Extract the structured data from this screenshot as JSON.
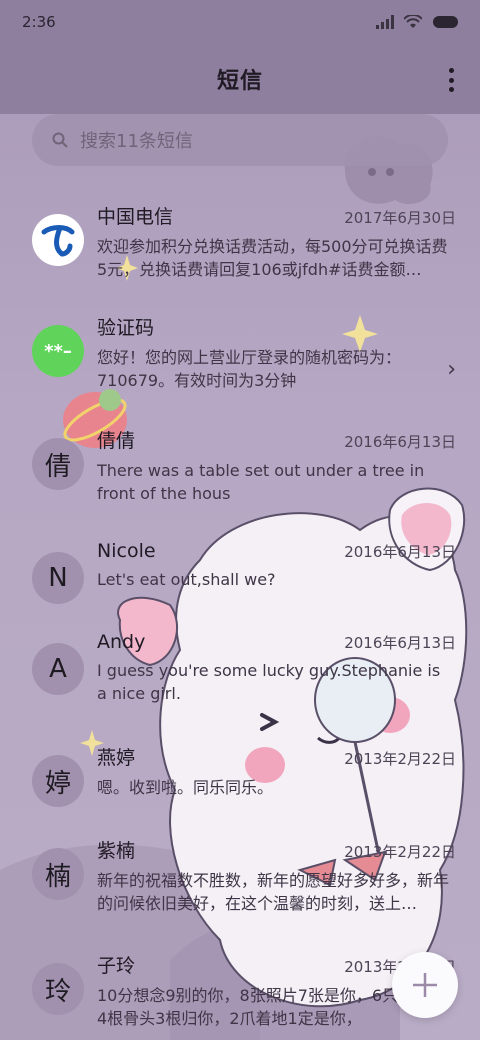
{
  "status": {
    "time": "2:36"
  },
  "header": {
    "title": "短信"
  },
  "search": {
    "placeholder": "搜索11条短信"
  },
  "conversations": [
    {
      "avatar_text": "",
      "avatar_icon": "china-telecom-logo-icon",
      "name": "中国电信",
      "date": "2017年6月30日",
      "snippet": "欢迎参加积分兑换话费活动，每500分可兑换话费5元，兑换话费请回复106或jfdh#话费金额…"
    },
    {
      "avatar_text": "**–",
      "avatar_icon": "verification-code-icon",
      "name": "验证码",
      "date": "",
      "snippet": "您好！您的网上营业厅登录的随机密码为：710679。有效时间为3分钟"
    },
    {
      "avatar_text": "倩",
      "name": "倩倩",
      "date": "2016年6月13日",
      "snippet": "There was a table set out under a tree in front of the hous"
    },
    {
      "avatar_text": "N",
      "name": "Nicole",
      "date": "2016年6月13日",
      "snippet": "Let's eat out,shall we?"
    },
    {
      "avatar_text": "A",
      "name": "Andy",
      "date": "2016年6月13日",
      "snippet": "I guess you're some lucky guy.Stephanie is a nice girl."
    },
    {
      "avatar_text": "婷",
      "name": "燕婷",
      "date": "2013年2月22日",
      "snippet": "嗯。收到啦。同乐同乐。"
    },
    {
      "avatar_text": "楠",
      "name": "紫楠",
      "date": "2013年2月22日",
      "snippet": "新年的祝福数不胜数，新年的愿望好多好多，新年的问候依旧美好，在这个温馨的时刻，送上…"
    },
    {
      "avatar_text": "玲",
      "name": "子玲",
      "date": "2013年2月22日",
      "snippet": "10分想念9别的你，8张照片7张是你，6只像你，4根骨头3根归你，2爪着地1定是你，"
    }
  ],
  "colors": {
    "accent_green": "#5fd35a",
    "telecom_blue": "#1a5bb5",
    "fab_plus": "#9b8aa8"
  }
}
